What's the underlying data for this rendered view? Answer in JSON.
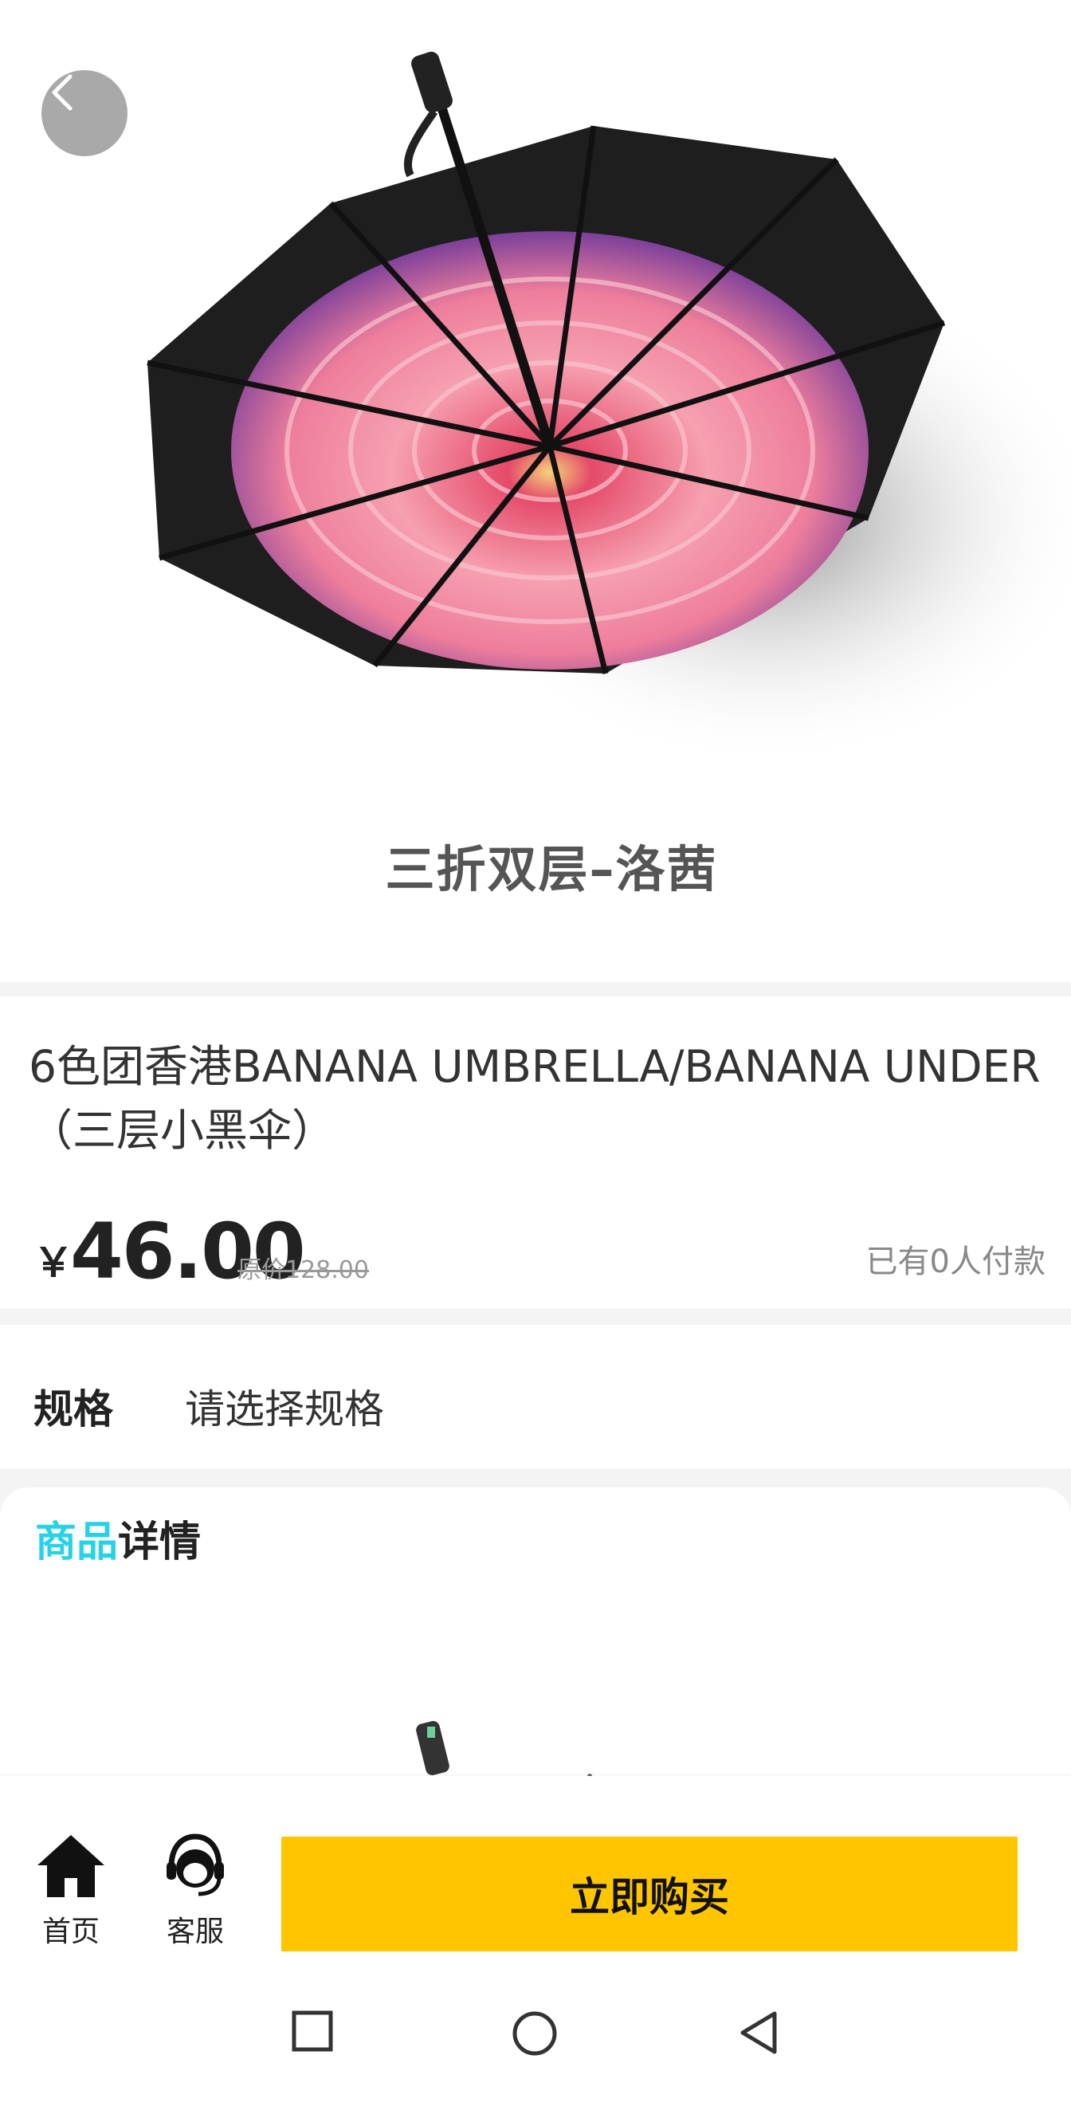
{
  "hero": {
    "caption": "三折双层–洛茜",
    "back_icon": "chevron-left-icon"
  },
  "product": {
    "title": "6色团香港BANANA UMBRELLA/BANANA UNDER（三层小黑伞）",
    "currency": "￥",
    "price": "46.00",
    "original_price": "原价128.00",
    "sold": "已有0人付款"
  },
  "spec": {
    "label": "规格",
    "value": "请选择规格"
  },
  "detail": {
    "title_highlight": "商品",
    "title_rest": "详情"
  },
  "bottom_bar": {
    "home_label": "首页",
    "home_icon": "home-icon",
    "service_label": "客服",
    "service_icon": "headset-icon",
    "buy_label": "立即购买"
  },
  "system_nav": {
    "recent_icon": "square-icon",
    "home_icon": "circle-icon",
    "back_icon": "triangle-back-icon"
  },
  "colors": {
    "accent_yellow": "#ffc600",
    "highlight_cyan": "#26d3e6"
  }
}
